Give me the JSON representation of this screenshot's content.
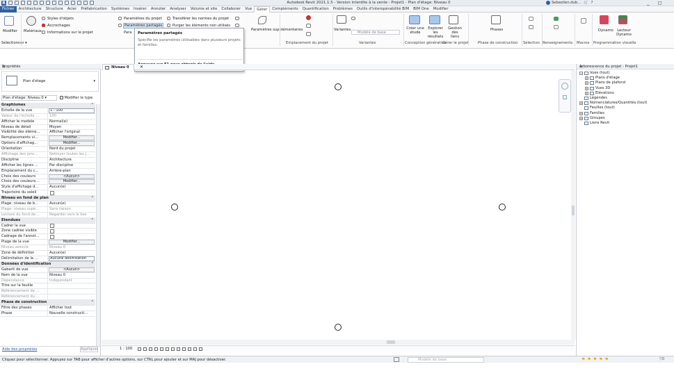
{
  "window": {
    "title": "Autodesk Revit 2021.1.5 - Version interdite à la vente - Projet1 - Plan d'étage: Niveau 0",
    "user": "Sebastien.dub...",
    "logo": "R",
    "controls": "_ ◻ ✕"
  },
  "tabs": [
    "Fichier",
    "Architecture",
    "Structure",
    "Acier",
    "Préfabrication",
    "Systèmes",
    "Insérer",
    "Annoter",
    "Analyser",
    "Volume et site",
    "Collaborer",
    "Vue",
    "Gérer",
    "Compléments",
    "Quantification",
    "Problèmes",
    "Outils d'interopérabilité BIM",
    "BIM One",
    "Modifier"
  ],
  "active_tab": "Gérer",
  "ribbon": {
    "select": {
      "modify": "Modifier",
      "label": "Sélectionner ▾"
    },
    "settings": {
      "materials": "Matériaux",
      "object_styles": "Styles d'objets",
      "snaps": "Accrochages",
      "project_info": "Informations sur le projet",
      "project_params": "Paramètres du projet",
      "shared_params": "Paramètres partagés",
      "params_short": "Para",
      "transfer": "Transférer les normes du projet",
      "purge": "Purger les éléments non utilisés",
      "additional": "Paramètres supplémentaires"
    },
    "location": {
      "label": "Emplacement du projet"
    },
    "variants": {
      "variants": "Variantes",
      "base_model": "Modèle de base",
      "label": "Variantes"
    },
    "generative": {
      "create": "Créer une étude",
      "explore": "Explorer les résultats",
      "manage": "Gestion des liens",
      "label": "Conception générative"
    },
    "manage_project": {
      "label": "Gérer le projet"
    },
    "phases": {
      "phases": "Phases",
      "label": "Phase de construction"
    },
    "selection": {
      "label": "Sélection"
    },
    "inquiry": {
      "label": "Renseignements"
    },
    "macros": {
      "label": "Macros"
    },
    "visual_programming": {
      "dynamo": "Dynamo",
      "player": "Lecteur Dynamo",
      "label": "Programmation visuelle"
    }
  },
  "tooltip": {
    "title": "Paramètres partagés",
    "description": "Spécifie les paramètres utilisables dans plusieurs projets et familles.",
    "help": "Appuyez sur F1 pour obtenir de l'aide"
  },
  "properties": {
    "title": "Propriétés",
    "type_name": "Plan d'étage",
    "filter_value": "Plan d'étage: Niveau 0",
    "edit_type": "Modifier le type",
    "help_link": "Aide des propriétés",
    "apply": "Appliquer",
    "rows": [
      {
        "kind": "sec",
        "k": "Graphismes"
      },
      {
        "k": "Echelle de la vue",
        "v": "1 : 100",
        "style": "input"
      },
      {
        "k": "Valeur de l'échelle ...",
        "v": "100",
        "dis": true
      },
      {
        "k": "Afficher le modèle",
        "v": "Normal(e)"
      },
      {
        "k": "Niveau de détail",
        "v": "Moyen"
      },
      {
        "k": "Visibilité des éléme...",
        "v": "Afficher l'original"
      },
      {
        "k": "Remplacements vi...",
        "v": "Modifier...",
        "style": "btn"
      },
      {
        "k": "Options d'affichag...",
        "v": "Modifier...",
        "style": "btn"
      },
      {
        "k": "Orientation",
        "v": "Nord du projet"
      },
      {
        "k": "Affichage des jonc...",
        "v": "Nettoyer toutes les j...",
        "dis": true
      },
      {
        "k": "Discipline",
        "v": "Architecture"
      },
      {
        "k": "Afficher les lignes ...",
        "v": "Par discipline"
      },
      {
        "k": "Emplacement du c...",
        "v": "Arrière-plan"
      },
      {
        "k": "Choix des couleurs",
        "v": "<Aucun>",
        "style": "btn"
      },
      {
        "k": "Choix des couleurs...",
        "v": "Modifier...",
        "style": "btn"
      },
      {
        "k": "Style d'affichage d...",
        "v": "Aucun(e)"
      },
      {
        "k": "Trajectoire du soleil",
        "v": "",
        "style": "cb"
      },
      {
        "kind": "sec",
        "k": "Niveau en fond de plan"
      },
      {
        "k": "Plage: niveau de b...",
        "v": "Aucun(e)"
      },
      {
        "k": "Plage: niveau supé...",
        "v": "Sans liaison",
        "dis": true
      },
      {
        "k": "Lecture du fond de...",
        "v": "Regarder vers le bas",
        "dis": true
      },
      {
        "kind": "sec",
        "k": "Etendues"
      },
      {
        "k": "Cadrer la vue",
        "v": "",
        "style": "cb"
      },
      {
        "k": "Zone cadrée visible",
        "v": "",
        "style": "cb"
      },
      {
        "k": "Cadrage de l'annot...",
        "v": "",
        "style": "cb"
      },
      {
        "k": "Plage de la vue",
        "v": "Modifier...",
        "style": "btn"
      },
      {
        "k": "Niveau associé",
        "v": "Niveau 0",
        "dis": true
      },
      {
        "k": "Zone de définition",
        "v": "Aucun(e)"
      },
      {
        "k": "Délimitation de la ...",
        "v": "Aucune délimitation",
        "style": "input"
      },
      {
        "kind": "sec",
        "k": "Données d'identification"
      },
      {
        "k": "Gabarit de vue",
        "v": "<Aucun>",
        "style": "btn"
      },
      {
        "k": "Nom de la vue",
        "v": "Niveau 0"
      },
      {
        "k": "Dépendance",
        "v": "Indépendant",
        "dis": true
      },
      {
        "k": "Titre sur la feuille",
        "v": ""
      },
      {
        "k": "Référencement de ...",
        "v": "",
        "dis": true
      },
      {
        "k": "Référencement du ...",
        "v": "",
        "dis": true
      },
      {
        "kind": "sec",
        "k": "Phase de construction"
      },
      {
        "k": "Filtre des phases",
        "v": "Afficher tout"
      },
      {
        "k": "Phase",
        "v": "Nouvelle constructi..."
      }
    ]
  },
  "canvas": {
    "view_tab": "Niveau 0",
    "view_tab_close": "✕",
    "scale": "1 : 100"
  },
  "browser": {
    "title": "Arborescence du projet - Projet1",
    "nodes": [
      {
        "level": 0,
        "pm": "−",
        "label": "Vues (tout)"
      },
      {
        "level": 1,
        "pm": "+",
        "label": "Plans d'étage"
      },
      {
        "level": 1,
        "pm": "+",
        "label": "Plans de plafond"
      },
      {
        "level": 1,
        "pm": "+",
        "label": "Vues 3D"
      },
      {
        "level": 1,
        "pm": "+",
        "label": "Elévations"
      },
      {
        "level": 0,
        "pm": "",
        "label": "Légendes"
      },
      {
        "level": 0,
        "pm": "+",
        "label": "Nomenclatures/Quantités (tout)"
      },
      {
        "level": 0,
        "pm": "",
        "label": "Feuilles (tout)"
      },
      {
        "level": 0,
        "pm": "+",
        "label": "Familles"
      },
      {
        "level": 0,
        "pm": "+",
        "label": "Groupes"
      },
      {
        "level": 0,
        "pm": "",
        "label": "Liens Revit"
      }
    ]
  },
  "status": {
    "text": "Cliquez pour sélectionner. Appuyez sur TAB pour afficher d'autres options, sur CTRL pour ajouter et sur MAJ pour désactiver.",
    "model": "Modèle de base",
    "zero": "0"
  },
  "colors": {
    "accent": "#2f5f9e",
    "ribbon_bg": "#fbfbfc"
  }
}
